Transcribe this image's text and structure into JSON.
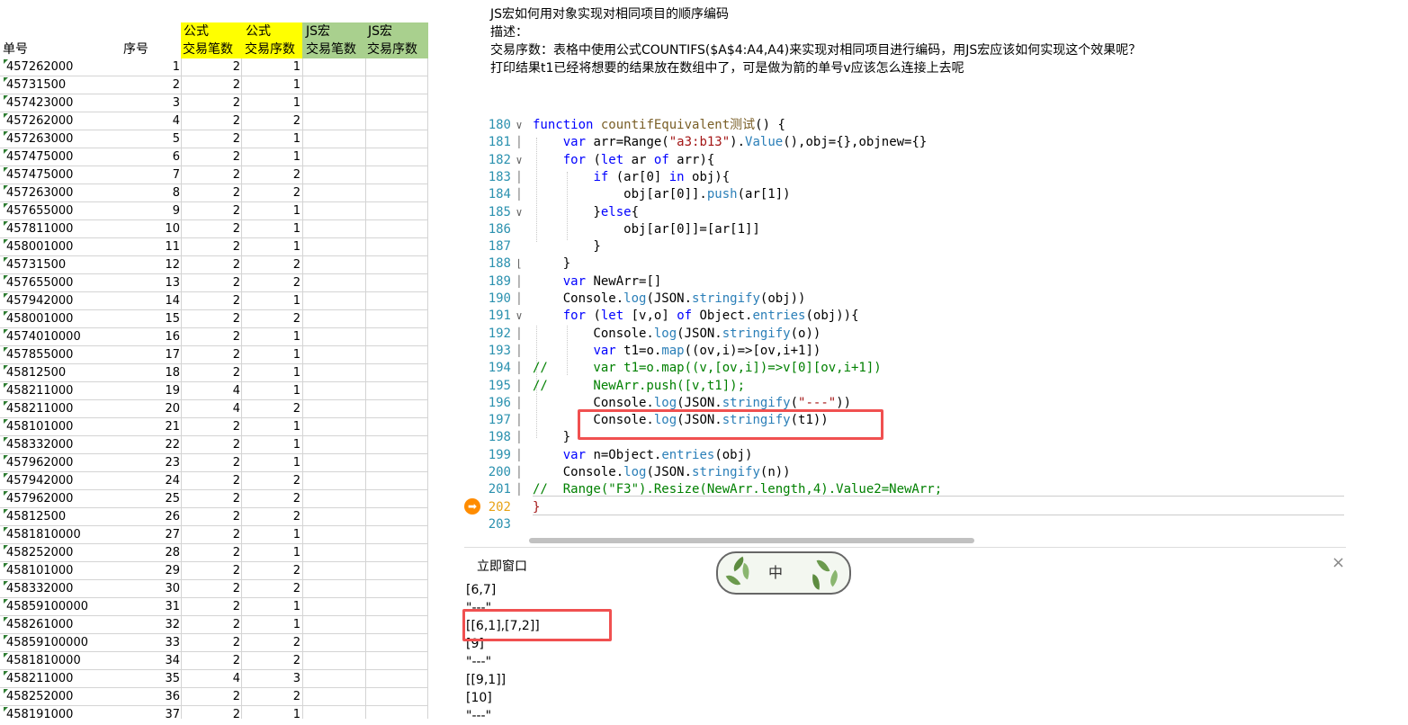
{
  "sheet": {
    "headers": {
      "a": "单号",
      "b": "序号",
      "c1": "公式",
      "c2": "交易笔数",
      "d1": "公式",
      "d2": "交易序数",
      "e1": "JS宏",
      "e2": "交易笔数",
      "f1": "JS宏",
      "f2": "交易序数"
    },
    "rows": [
      [
        "457262000",
        "1",
        "2",
        "1"
      ],
      [
        "45731500",
        "2",
        "2",
        "1"
      ],
      [
        "457423000",
        "3",
        "2",
        "1"
      ],
      [
        "457262000",
        "4",
        "2",
        "2"
      ],
      [
        "457263000",
        "5",
        "2",
        "1"
      ],
      [
        "457475000",
        "6",
        "2",
        "1"
      ],
      [
        "457475000",
        "7",
        "2",
        "2"
      ],
      [
        "457263000",
        "8",
        "2",
        "2"
      ],
      [
        "457655000",
        "9",
        "2",
        "1"
      ],
      [
        "457811000",
        "10",
        "2",
        "1"
      ],
      [
        "458001000",
        "11",
        "2",
        "1"
      ],
      [
        "45731500",
        "12",
        "2",
        "2"
      ],
      [
        "457655000",
        "13",
        "2",
        "2"
      ],
      [
        "457942000",
        "14",
        "2",
        "1"
      ],
      [
        "458001000",
        "15",
        "2",
        "2"
      ],
      [
        "4574010000",
        "16",
        "2",
        "1"
      ],
      [
        "457855000",
        "17",
        "2",
        "1"
      ],
      [
        "45812500",
        "18",
        "2",
        "1"
      ],
      [
        "458211000",
        "19",
        "4",
        "1"
      ],
      [
        "458211000",
        "20",
        "4",
        "2"
      ],
      [
        "458101000",
        "21",
        "2",
        "1"
      ],
      [
        "458332000",
        "22",
        "2",
        "1"
      ],
      [
        "457962000",
        "23",
        "2",
        "1"
      ],
      [
        "457942000",
        "24",
        "2",
        "2"
      ],
      [
        "457962000",
        "25",
        "2",
        "2"
      ],
      [
        "45812500",
        "26",
        "2",
        "2"
      ],
      [
        "4581810000",
        "27",
        "2",
        "1"
      ],
      [
        "458252000",
        "28",
        "2",
        "1"
      ],
      [
        "458101000",
        "29",
        "2",
        "2"
      ],
      [
        "458332000",
        "30",
        "2",
        "2"
      ],
      [
        "45859100000",
        "31",
        "2",
        "1"
      ],
      [
        "458261000",
        "32",
        "2",
        "1"
      ],
      [
        "45859100000",
        "33",
        "2",
        "2"
      ],
      [
        "4581810000",
        "34",
        "2",
        "2"
      ],
      [
        "458211000",
        "35",
        "4",
        "3"
      ],
      [
        "458252000",
        "36",
        "2",
        "2"
      ],
      [
        "458191000",
        "37",
        "2",
        "1"
      ]
    ]
  },
  "question": {
    "title": "JS宏如何用对象实现对相同项目的顺序编码",
    "desc_label": "描述：",
    "line1": "交易序数：表格中使用公式COUNTIFS($A$4:A4,A4)来实现对相同项目进行编码，用JS宏应该如何实现这个效果呢？",
    "line2": "打印结果t1已经将想要的结果放在数组中了，可是做为箭的单号v应该怎么连接上去呢"
  },
  "code": {
    "line_numbers": [
      "180",
      "181",
      "182",
      "183",
      "184",
      "185",
      "186",
      "187",
      "188",
      "189",
      "190",
      "191",
      "192",
      "193",
      "194",
      "195",
      "196",
      "197",
      "198",
      "199",
      "200",
      "201",
      "202",
      "203"
    ],
    "l180": [
      "function",
      " ",
      "countifEquivalent测试",
      "() {"
    ],
    "l181": [
      "    ",
      "var",
      " arr=Range(",
      "\"a3:b13\"",
      ").",
      "Value",
      "(),obj={},objnew={}"
    ],
    "l182": [
      "    ",
      "for",
      " (",
      "let",
      " ar ",
      "of",
      " arr){"
    ],
    "l183": [
      "        ",
      "if",
      " (ar[0] ",
      "in",
      " obj){"
    ],
    "l184": [
      "            obj[ar[0]].",
      "push",
      "(ar[1])"
    ],
    "l185": [
      "        }",
      "else",
      "{"
    ],
    "l186": "            obj[ar[0]]=[ar[1]]",
    "l187": "        }",
    "l188": "    }",
    "l189": [
      "    ",
      "var",
      " NewArr=[]"
    ],
    "l190": [
      "    Console.",
      "log",
      "(JSON.",
      "stringify",
      "(obj))"
    ],
    "l191": [
      "    ",
      "for",
      " (",
      "let",
      " [v,o] ",
      "of",
      " Object.",
      "entries",
      "(obj)){"
    ],
    "l192": [
      "        Console.",
      "log",
      "(JSON.",
      "stringify",
      "(o))"
    ],
    "l193": [
      "        ",
      "var",
      " t1=o.",
      "map",
      "((ov,i)=>[ov,i+1])"
    ],
    "l194": "//      var t1=o.map((v,[ov,i])=>v[0][ov,i+1])",
    "l195": "//      NewArr.push([v,t1]);",
    "l196": [
      "        Console.",
      "log",
      "(JSON.",
      "stringify",
      "(",
      "\"---\"",
      "))"
    ],
    "l197": [
      "        Console.",
      "log",
      "(JSON.",
      "stringify",
      "(t1))"
    ],
    "l198": "    }",
    "l199": [
      "    ",
      "var",
      " n=Object.",
      "entries",
      "(obj)"
    ],
    "l200": [
      "    Console.",
      "log",
      "(JSON.",
      "stringify",
      "(n))"
    ],
    "l201": "//  Range(\"F3\").Resize(NewArr.length,4).Value2=NewArr;",
    "l202": "}",
    "fold_marks": {
      "open": "∨",
      "end": "⌊",
      "bar": "│"
    }
  },
  "immediate": {
    "title": "立即窗口",
    "close": "×",
    "ime_label": "中",
    "lines": [
      "[6,7]",
      "\"---\"",
      "[[6,1],[7,2]]",
      "[9]",
      "\"---\"",
      "[[9,1]]",
      "[10]",
      "\"---\""
    ]
  },
  "colors": {
    "header_yellow": "#ffff00",
    "header_green": "#a9d08e",
    "highlight_red": "#f05050",
    "breakpoint": "#ff8c00"
  }
}
